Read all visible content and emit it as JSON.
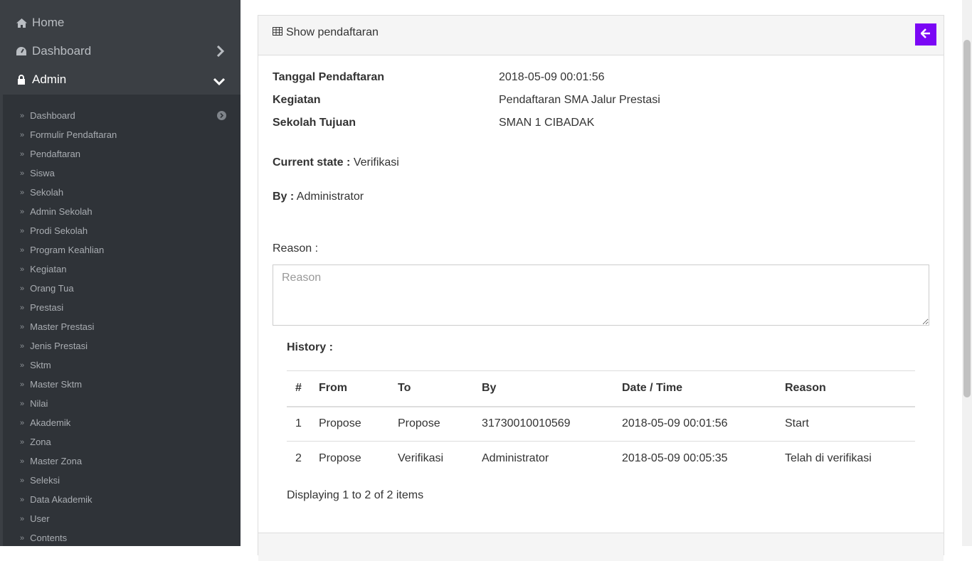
{
  "sidebar": {
    "top_items": [
      {
        "label": "Home",
        "icon": "home-icon"
      },
      {
        "label": "Dashboard",
        "icon": "dashboard-icon"
      },
      {
        "label": "Admin",
        "icon": "lock-icon"
      }
    ],
    "sub_items": [
      "Dashboard",
      "Formulir Pendaftaran",
      "Pendaftaran",
      "Siswa",
      "Sekolah",
      "Admin Sekolah",
      "Prodi Sekolah",
      "Program Keahlian",
      "Kegiatan",
      "Orang Tua",
      "Prestasi",
      "Master Prestasi",
      "Jenis Prestasi",
      "Sktm",
      "Master Sktm",
      "Nilai",
      "Akademik",
      "Zona",
      "Master Zona",
      "Seleksi",
      "Data Akademik",
      "User",
      "Contents"
    ]
  },
  "panel": {
    "title": "Show pendaftaran",
    "back_button_color": "#7b07f5"
  },
  "details": {
    "tanggal_label": "Tanggal Pendaftaran",
    "tanggal_value": "2018-05-09 00:01:56",
    "kegiatan_label": "Kegiatan",
    "kegiatan_value": "Pendaftaran SMA Jalur Prestasi",
    "sekolah_label": "Sekolah Tujuan",
    "sekolah_value": "SMAN 1 CIBADAK"
  },
  "state": {
    "current_label": "Current state :",
    "current_value": "Verifikasi",
    "by_label": "By :",
    "by_value": "Administrator"
  },
  "reason": {
    "label": "Reason :",
    "placeholder": "Reason"
  },
  "history": {
    "title": "History :",
    "columns": [
      "#",
      "From",
      "To",
      "By",
      "Date / Time",
      "Reason"
    ],
    "rows": [
      [
        "1",
        "Propose",
        "Propose",
        "31730010010569",
        "2018-05-09 00:01:56",
        "Start"
      ],
      [
        "2",
        "Propose",
        "Verifikasi",
        "Administrator",
        "2018-05-09 00:05:35",
        "Telah di verifikasi"
      ]
    ],
    "summary": "Displaying 1 to 2 of 2 items"
  }
}
